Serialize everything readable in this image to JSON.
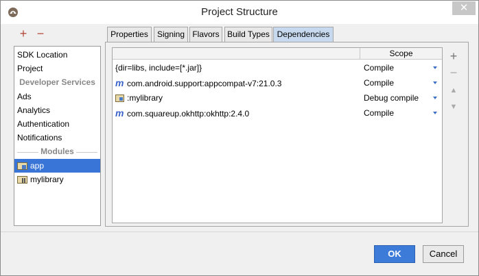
{
  "window": {
    "title": "Project Structure",
    "close_glyph": "✕"
  },
  "toolbar": {
    "add_glyph": "+",
    "remove_glyph": "−"
  },
  "sidebar": {
    "items_top": [
      {
        "label": "SDK Location"
      },
      {
        "label": "Project"
      }
    ],
    "section_developer_services": "Developer Services",
    "services": [
      {
        "label": "Ads"
      },
      {
        "label": "Analytics"
      },
      {
        "label": "Authentication"
      },
      {
        "label": "Notifications"
      }
    ],
    "section_modules": "Modules",
    "modules": [
      {
        "label": "app",
        "selected": true
      },
      {
        "label": "mylibrary",
        "selected": false
      }
    ]
  },
  "tabs": [
    {
      "label": "Properties"
    },
    {
      "label": "Signing"
    },
    {
      "label": "Flavors"
    },
    {
      "label": "Build Types"
    },
    {
      "label": "Dependencies",
      "active": true
    }
  ],
  "table": {
    "scope_header": "Scope",
    "rows": [
      {
        "name": "{dir=libs, include=[*.jar]}",
        "scope": "Compile",
        "icon": "none"
      },
      {
        "name": "com.android.support:appcompat-v7:21.0.3",
        "scope": "Compile",
        "icon": "maven-icon"
      },
      {
        "name": ":mylibrary",
        "scope": "Debug compile",
        "icon": "module-icon"
      },
      {
        "name": "com.squareup.okhttp:okhttp:2.4.0",
        "scope": "Compile",
        "icon": "maven-icon"
      }
    ],
    "maven_glyph": "m"
  },
  "side_tools": {
    "add": "+",
    "remove": "−",
    "up": "▲",
    "down": "▼"
  },
  "buttons": {
    "ok": "OK",
    "cancel": "Cancel"
  },
  "colors": {
    "selection": "#3875d7",
    "active_tab": "#c7d9ee",
    "ok_button": "#3d7bd9",
    "accent_red": "#b54a3a",
    "maven_blue": "#3b63c9"
  }
}
